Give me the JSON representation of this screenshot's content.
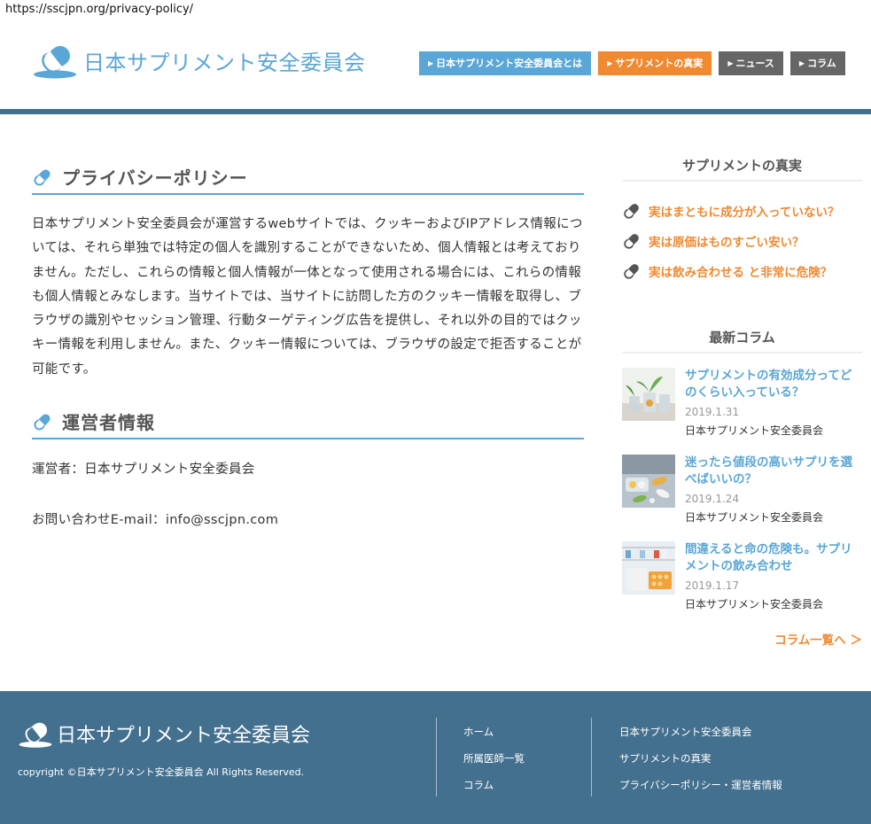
{
  "browser": {
    "url": "https://sscjpn.org/privacy-policy/"
  },
  "site": {
    "name": "日本サプリメント安全委員会"
  },
  "nav": [
    {
      "label": "日本サプリメント安全委員会とは"
    },
    {
      "label": "サプリメントの真実"
    },
    {
      "label": "ニュース"
    },
    {
      "label": "コラム"
    }
  ],
  "colors": {
    "accent_blue": "#5aa6d6",
    "accent_orange": "#f08930",
    "nav_gray": "#666666",
    "footer_bg": "#44708f"
  },
  "main": {
    "privacy": {
      "title": "プライバシーポリシー",
      "body": "日本サプリメント安全委員会が運営するwebサイトでは、クッキーおよびIPアドレス情報については、それら単独では特定の個人を識別することができないため、個人情報とは考えておりません。ただし、これらの情報と個人情報が一体となって使用される場合には、これらの情報も個人情報とみなします。当サイトでは、当サイトに訪問した方のクッキー情報を取得し、ブラウザの識別やセッション管理、行動ターゲティング広告を提供し、それ以外の目的ではクッキー情報を利用しません。また、クッキー情報については、ブラウザの設定で拒否することが可能です。"
    },
    "operator": {
      "title": "運営者情報",
      "name_line": "運営者：日本サプリメント安全委員会",
      "email_line": "お問い合わせE-mail：info@sscjpn.com"
    }
  },
  "sidebar": {
    "truth": {
      "heading": "サプリメントの真実",
      "items": [
        {
          "label": "実はまともに成分が入っていない？"
        },
        {
          "label": "実は原価はものすごい安い？"
        },
        {
          "label": "実は飲み合わせる と非常に危険？"
        }
      ]
    },
    "columns": {
      "heading": "最新コラム",
      "items": [
        {
          "title": "サプリメントの有効成分ってどのくらい入っている？",
          "date": "2019.1.31",
          "author": "日本サプリメント安全委員会"
        },
        {
          "title": "迷ったら値段の高いサプリを選べばいいの？",
          "date": "2019.1.24",
          "author": "日本サプリメント安全委員会"
        },
        {
          "title": "間違えると命の危険も。サプリメントの飲み合わせ",
          "date": "2019.1.17",
          "author": "日本サプリメント安全委員会"
        }
      ],
      "more": "コラム一覧へ ＞"
    }
  },
  "footer": {
    "copyright": "copyright ©日本サプリメント安全委員会 All Rights Reserved.",
    "links_col1": [
      {
        "label": "ホーム"
      },
      {
        "label": "所属医師一覧"
      },
      {
        "label": "コラム"
      }
    ],
    "links_col2": [
      {
        "label": "日本サプリメント安全委員会"
      },
      {
        "label": "サプリメントの真実"
      },
      {
        "label": "プライバシーポリシー・運営者情報"
      }
    ]
  }
}
